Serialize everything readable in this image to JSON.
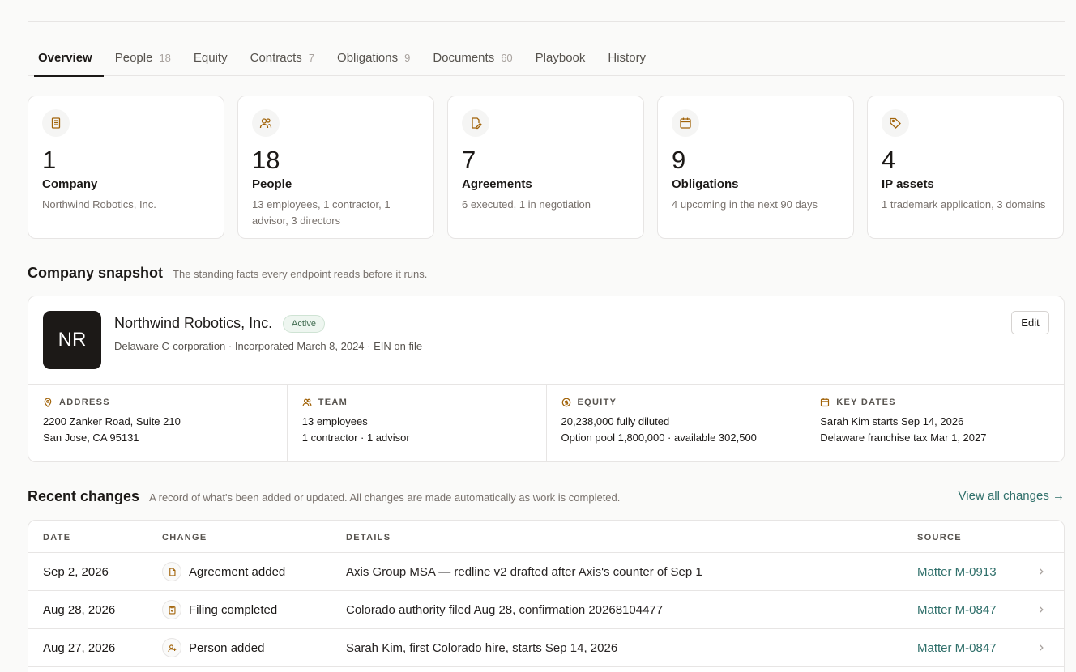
{
  "tabs": [
    {
      "label": "Overview",
      "count": ""
    },
    {
      "label": "People",
      "count": "18"
    },
    {
      "label": "Equity",
      "count": ""
    },
    {
      "label": "Contracts",
      "count": "7"
    },
    {
      "label": "Obligations",
      "count": "9"
    },
    {
      "label": "Documents",
      "count": "60"
    },
    {
      "label": "Playbook",
      "count": ""
    },
    {
      "label": "History",
      "count": ""
    }
  ],
  "stats": [
    {
      "icon": "building-icon",
      "value": "1",
      "label": "Company",
      "desc": "Northwind Robotics, Inc."
    },
    {
      "icon": "people-icon",
      "value": "18",
      "label": "People",
      "desc": "13 employees, 1 contractor, 1 advisor, 3 directors"
    },
    {
      "icon": "signature-icon",
      "value": "7",
      "label": "Agreements",
      "desc": "6 executed, 1 in negotiation"
    },
    {
      "icon": "calendar-icon",
      "value": "9",
      "label": "Obligations",
      "desc": "4 upcoming in the next 90 days"
    },
    {
      "icon": "tag-icon",
      "value": "4",
      "label": "IP assets",
      "desc": "1 trademark application, 3 domains"
    }
  ],
  "snapshot": {
    "title": "Company snapshot",
    "subtitle": "The standing facts every endpoint reads before it runs.",
    "logo_text": "NR",
    "company_name": "Northwind Robotics, Inc.",
    "status": "Active",
    "meta": "Delaware C-corporation · Incorporated March 8, 2024 · EIN on file",
    "edit_label": "Edit",
    "facts": [
      {
        "icon": "pin-icon",
        "heading": "ADDRESS",
        "line1": "2200 Zanker Road, Suite 210",
        "line2": "San Jose, CA 95131"
      },
      {
        "icon": "people-icon",
        "heading": "TEAM",
        "line1": "13 employees",
        "line2": "1 contractor · 1 advisor"
      },
      {
        "icon": "coin-icon",
        "heading": "EQUITY",
        "line1": "20,238,000 fully diluted",
        "line2": "Option pool 1,800,000 · available 302,500"
      },
      {
        "icon": "calendar-icon",
        "heading": "KEY DATES",
        "line1": "Sarah Kim starts Sep 14, 2026",
        "line2": "Delaware franchise tax Mar 1, 2027"
      }
    ]
  },
  "changes": {
    "title": "Recent changes",
    "subtitle": "A record of what's been added or updated. All changes are made automatically as work is completed.",
    "view_all": "View all changes →",
    "headers": {
      "date": "DATE",
      "change": "CHANGE",
      "details": "DETAILS",
      "source": "SOURCE"
    },
    "rows": [
      {
        "date": "Sep 2, 2026",
        "icon": "document-icon",
        "change": "Agreement added",
        "details": "Axis Group MSA — redline v2 drafted after Axis's counter of Sep 1",
        "source": "Matter M-0913"
      },
      {
        "date": "Aug 28, 2026",
        "icon": "clipboard-icon",
        "change": "Filing completed",
        "details": "Colorado authority filed Aug 28, confirmation 20268104477",
        "source": "Matter M-0847"
      },
      {
        "date": "Aug 27, 2026",
        "icon": "person-add-icon",
        "change": "Person added",
        "details": "Sarah Kim, first Colorado hire, starts Sep 14, 2026",
        "source": "Matter M-0847"
      }
    ]
  },
  "colors": {
    "accent": "#a16207",
    "link": "#2f6f6a",
    "active_badge": "#eef6f0"
  }
}
